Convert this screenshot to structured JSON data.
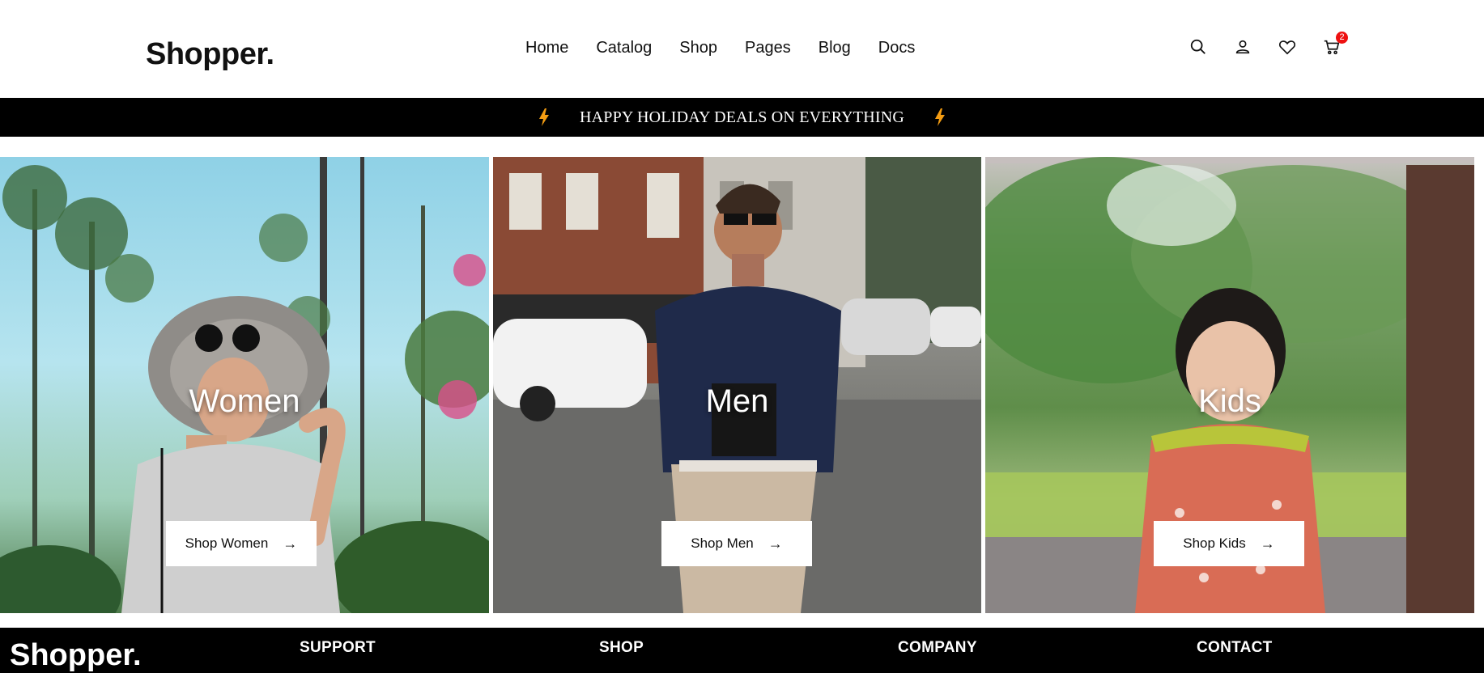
{
  "header": {
    "logo": "Shopper.",
    "nav": [
      "Home",
      "Catalog",
      "Shop",
      "Pages",
      "Blog",
      "Docs"
    ],
    "icons": [
      "search-icon",
      "user-icon",
      "heart-icon",
      "cart-icon"
    ],
    "cart_count": "2"
  },
  "promo": {
    "text": "HAPPY HOLIDAY DEALS ON EVERYTHING",
    "icon": "bolt-icon",
    "icon_color": "#f39c12"
  },
  "tiles": [
    {
      "title": "Women",
      "button": "Shop Women"
    },
    {
      "title": "Men",
      "button": "Shop Men"
    },
    {
      "title": "Kids",
      "button": "Shop Kids"
    }
  ],
  "footer": {
    "logo": "Shopper.",
    "columns": [
      "SUPPORT",
      "SHOP",
      "COMPANY",
      "CONTACT"
    ]
  },
  "colors": {
    "badge": "#e11111",
    "bar": "#000000"
  }
}
